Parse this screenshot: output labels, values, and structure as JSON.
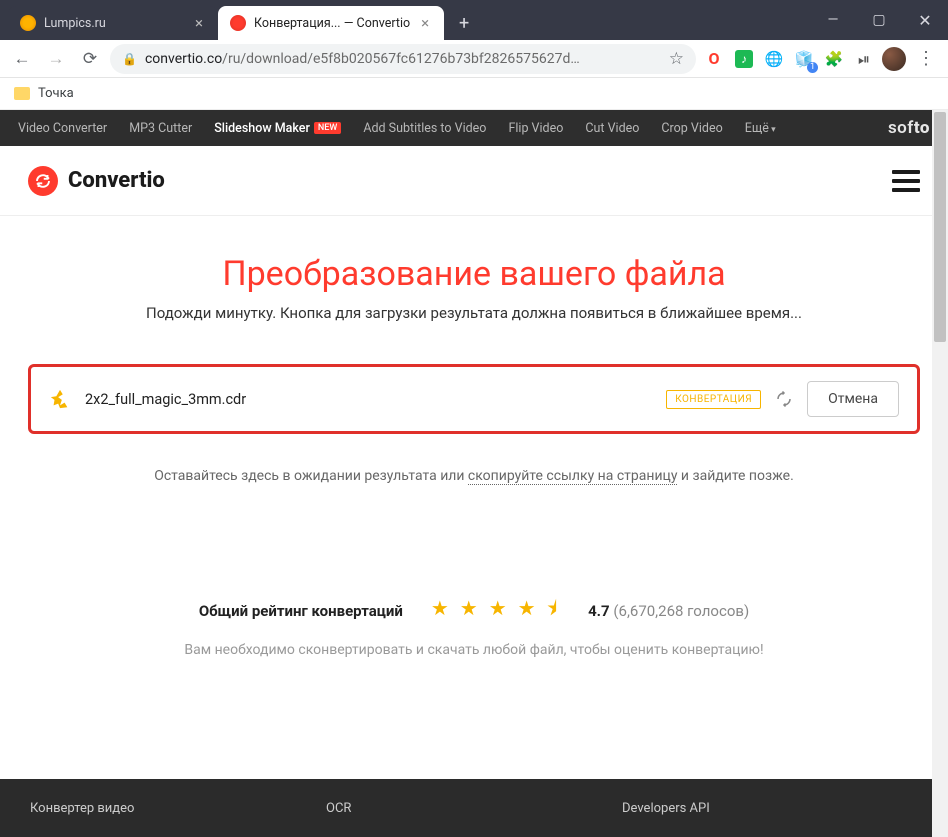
{
  "browser": {
    "tabs": [
      {
        "title": "Lumpics.ru"
      },
      {
        "title": "Конвертация... — Convertio"
      }
    ],
    "url_host": "convertio.co",
    "url_path": "/ru/download/e5f8b020567fc61276b73bf2826575627d…"
  },
  "bookmarks": {
    "item0": "Точка"
  },
  "topnav": {
    "items": [
      "Video Converter",
      "MP3 Cutter",
      "Slideshow Maker",
      "Add Subtitles to Video",
      "Flip Video",
      "Cut Video",
      "Crop Video",
      "Ещё"
    ],
    "badge": "NEW",
    "brand_light": "sof",
    "brand_bold": "to"
  },
  "header": {
    "logo": "Convertio"
  },
  "main": {
    "heading": "Преобразование вашего файла",
    "subtitle": "Подожди минутку. Кнопка для загрузки результата должна появиться в ближайшее время...",
    "file": {
      "name": "2x2_full_magic_3mm.cdr",
      "status": "КОНВЕРТАЦИЯ",
      "cancel": "Отмена"
    },
    "wait_pre": "Оставайтесь здесь в ожидании результата или ",
    "wait_link": "скопируйте ссылку на страницу",
    "wait_post": " и зайдите позже."
  },
  "rating": {
    "label": "Общий рейтинг конвертаций",
    "stars": "★ ★ ★ ★ ⯨",
    "score": "4.7",
    "votes": "(6,670,268 голосов)",
    "msg": "Вам необходимо сконвертировать и скачать любой файл, чтобы оценить конвертацию!"
  },
  "footer": {
    "col0": "Конвертер видео",
    "col1": "OCR",
    "col2": "Developers API"
  }
}
